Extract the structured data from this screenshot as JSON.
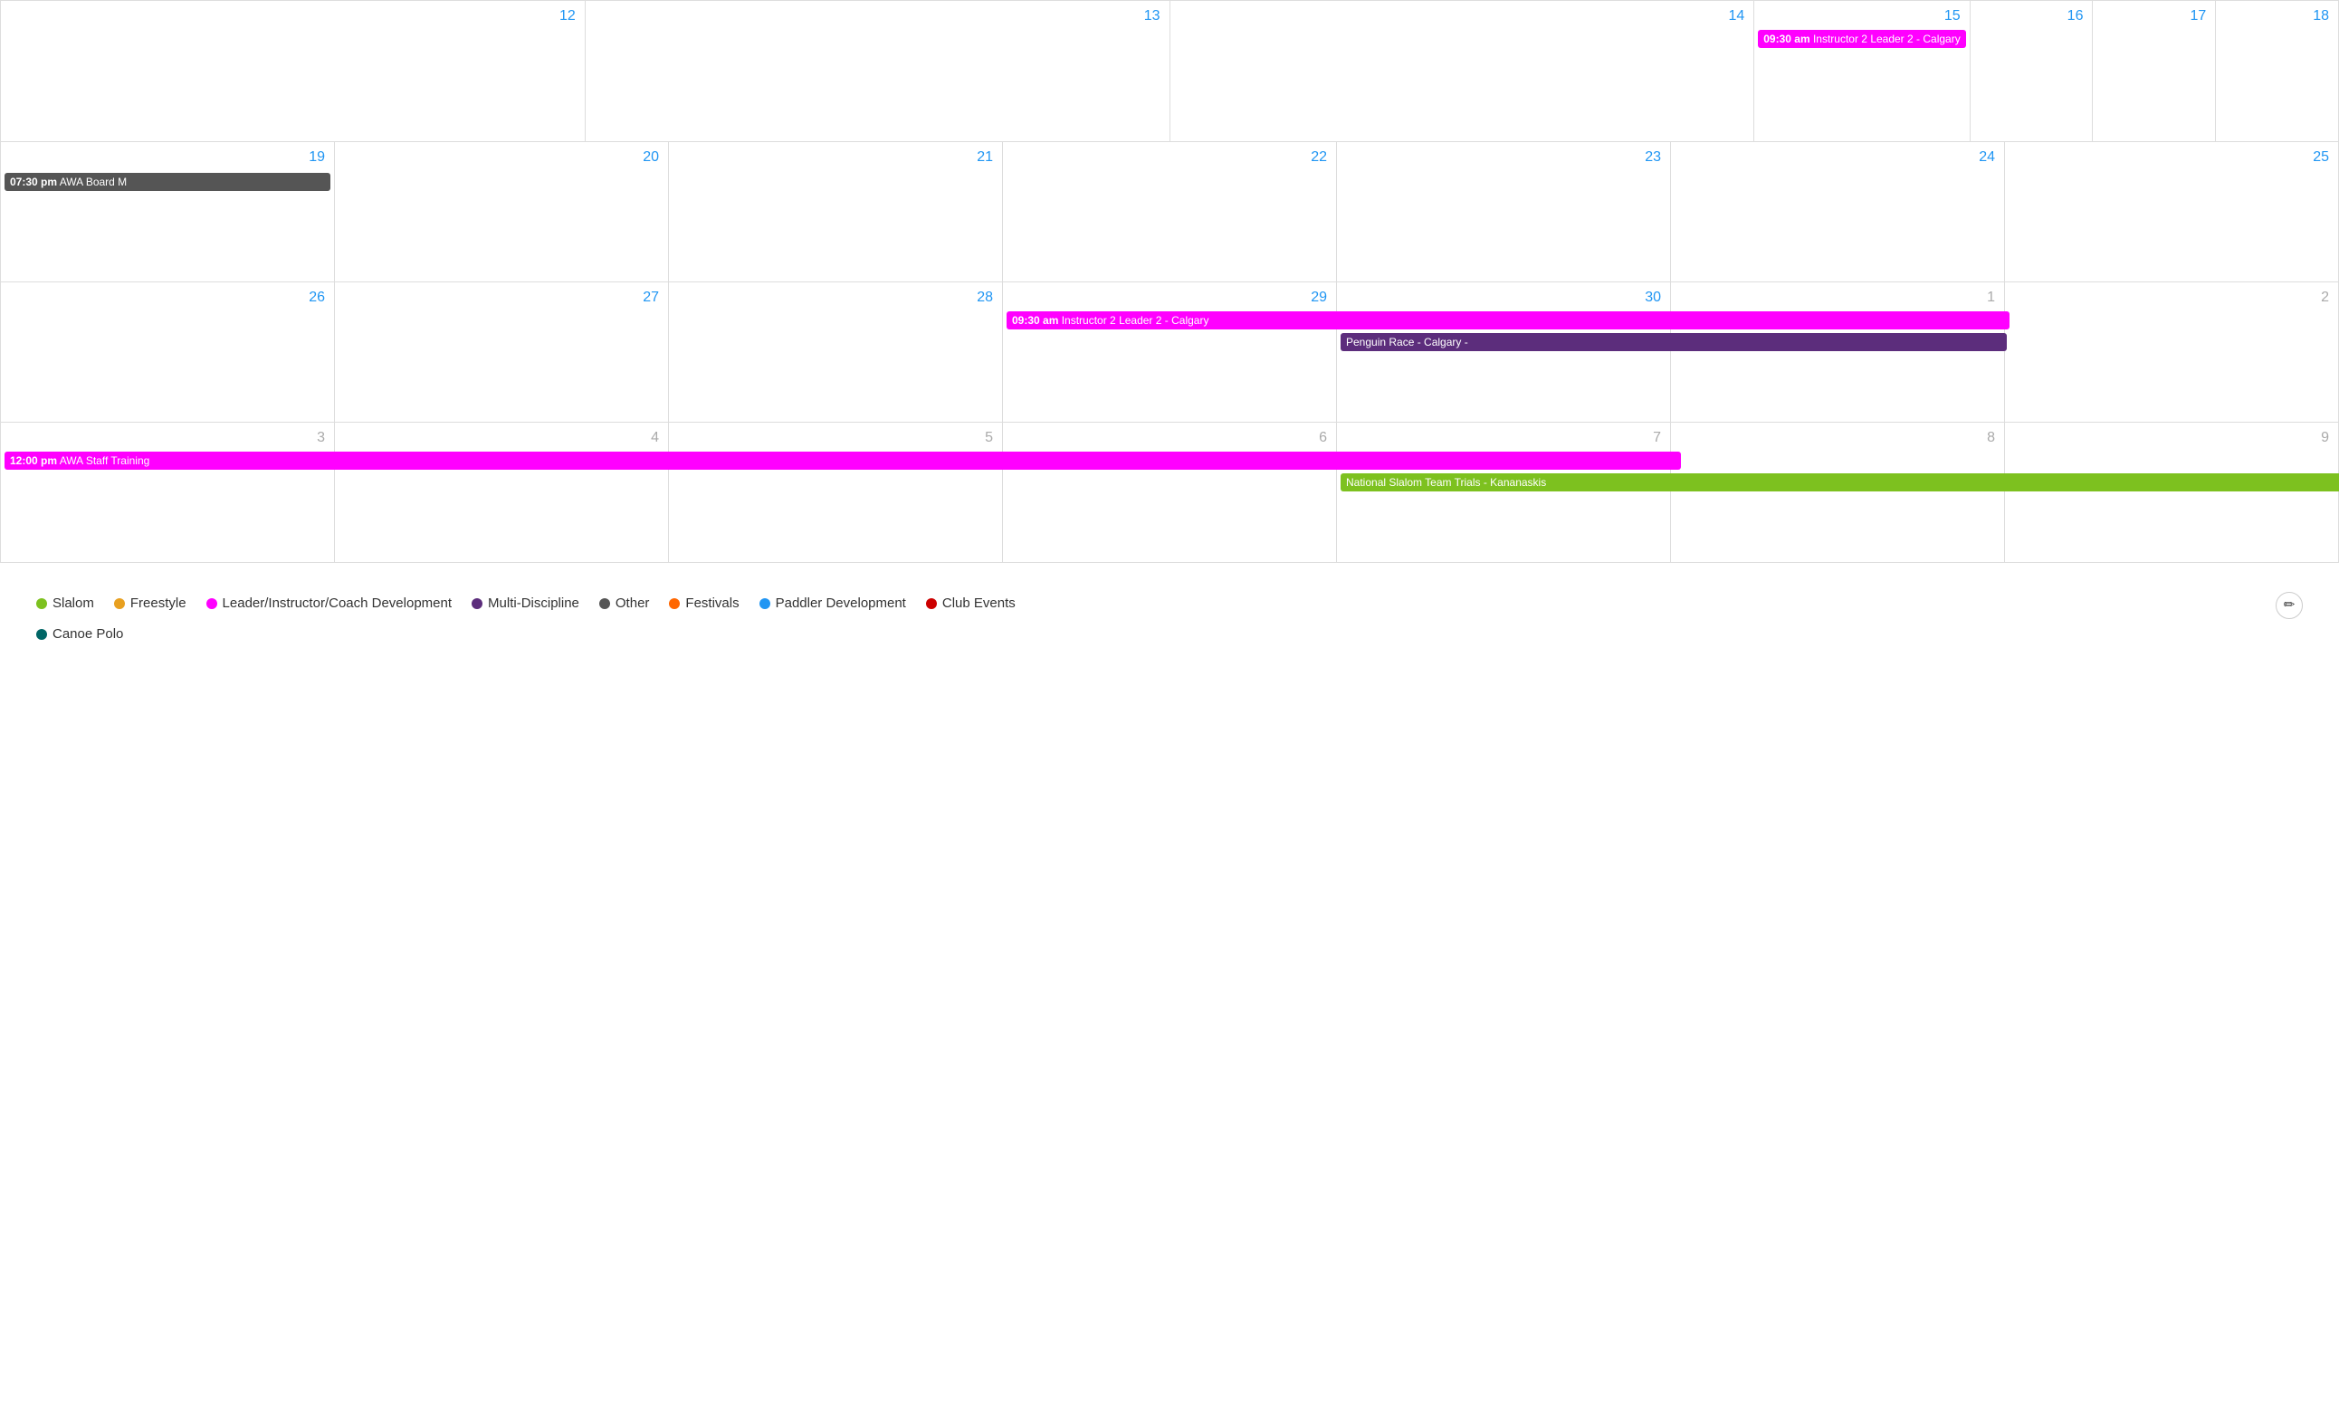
{
  "calendar": {
    "weeks": [
      {
        "days": [
          {
            "number": "12",
            "monthType": "current"
          },
          {
            "number": "13",
            "monthType": "current"
          },
          {
            "number": "14",
            "monthType": "current"
          },
          {
            "number": "15",
            "monthType": "current"
          },
          {
            "number": "16",
            "monthType": "current"
          },
          {
            "number": "17",
            "monthType": "current"
          },
          {
            "number": "18",
            "monthType": "current"
          }
        ],
        "events": [
          {
            "startDay": 3,
            "span": 4,
            "label": "09:30 am Instructor 2 Leader 2 - Calgary",
            "time": "09:30 am",
            "title": "Instructor 2 Leader 2 - Calgary",
            "color": "magenta"
          }
        ]
      },
      {
        "days": [
          {
            "number": "19",
            "monthType": "current"
          },
          {
            "number": "20",
            "monthType": "current"
          },
          {
            "number": "21",
            "monthType": "current"
          },
          {
            "number": "22",
            "monthType": "current"
          },
          {
            "number": "23",
            "monthType": "current"
          },
          {
            "number": "24",
            "monthType": "current"
          },
          {
            "number": "25",
            "monthType": "current"
          }
        ],
        "events": [
          {
            "startDay": 0,
            "span": 1,
            "label": "07:30 pm AWA Board M",
            "time": "07:30 pm",
            "title": "AWA Board M",
            "color": "darkgray"
          }
        ]
      },
      {
        "days": [
          {
            "number": "26",
            "monthType": "current"
          },
          {
            "number": "27",
            "monthType": "current"
          },
          {
            "number": "28",
            "monthType": "current"
          },
          {
            "number": "29",
            "monthType": "current"
          },
          {
            "number": "30",
            "monthType": "current"
          },
          {
            "number": "1",
            "monthType": "next"
          },
          {
            "number": "2",
            "monthType": "next"
          }
        ],
        "events": [
          {
            "startDay": 3,
            "span": 4,
            "label": "09:30 am Instructor 2 Leader 2 - Calgary",
            "time": "09:30 am",
            "title": "Instructor 2 Leader 2 - Calgary",
            "color": "magenta"
          },
          {
            "startDay": 4,
            "span": 2,
            "label": "Penguin Race - Calgary -",
            "time": "",
            "title": "Penguin Race - Calgary -",
            "color": "purple"
          }
        ]
      },
      {
        "days": [
          {
            "number": "3",
            "monthType": "next"
          },
          {
            "number": "4",
            "monthType": "next"
          },
          {
            "number": "5",
            "monthType": "next"
          },
          {
            "number": "6",
            "monthType": "next"
          },
          {
            "number": "7",
            "monthType": "next"
          },
          {
            "number": "8",
            "monthType": "next"
          },
          {
            "number": "9",
            "monthType": "next"
          }
        ],
        "events": [
          {
            "startDay": 0,
            "span": 5,
            "label": "12:00 pm AWA Staff Training",
            "time": "12:00 pm",
            "title": "AWA Staff Training",
            "color": "magenta"
          },
          {
            "startDay": 4,
            "span": 3,
            "label": "National Slalom Team Trials - Kananaskis",
            "time": "",
            "title": "National Slalom Team Trials - Kananaskis",
            "color": "green"
          }
        ]
      }
    ],
    "legend": {
      "items": [
        {
          "label": "Slalom",
          "color": "#7DC11F"
        },
        {
          "label": "Freestyle",
          "color": "#E8A020"
        },
        {
          "label": "Leader/Instructor/Coach Development",
          "color": "#FF00FF"
        },
        {
          "label": "Multi-Discipline",
          "color": "#5C2D7C"
        },
        {
          "label": "Other",
          "color": "#555555"
        },
        {
          "label": "Festivals",
          "color": "#FF6600"
        },
        {
          "label": "Paddler Development",
          "color": "#2196F3"
        },
        {
          "label": "Club Events",
          "color": "#CC0000"
        },
        {
          "label": "Canoe Polo",
          "color": "#006666"
        }
      ],
      "edit_icon": "✏"
    }
  }
}
